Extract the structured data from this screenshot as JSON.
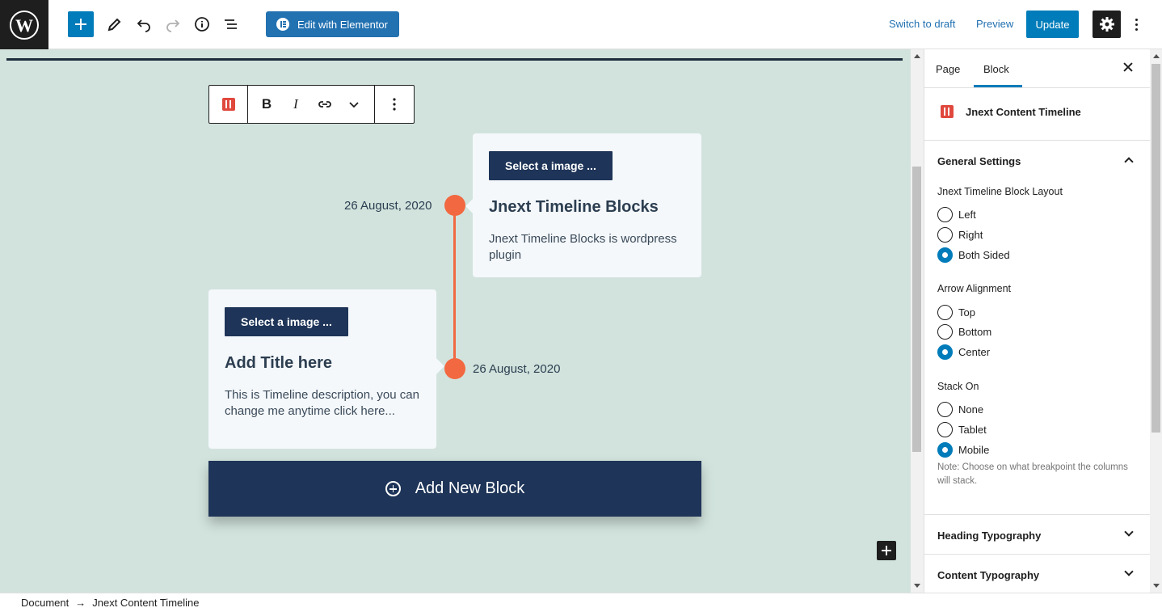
{
  "topbar": {
    "edit_elementor": "Edit with Elementor",
    "switch_to_draft": "Switch to draft",
    "preview": "Preview",
    "update": "Update"
  },
  "block_toolbar": {
    "bold": "B",
    "italic": "I"
  },
  "timeline": {
    "items": [
      {
        "date": "26 August, 2020",
        "button": "Select a image ...",
        "title": "Jnext Timeline Blocks",
        "description": "Jnext Timeline Blocks is wordpress plugin"
      },
      {
        "date": "26 August, 2020",
        "button": "Select a image ...",
        "title": "Add Title here",
        "description": "This is Timeline description, you can change me anytime click here..."
      }
    ],
    "add_new_block": "Add New Block"
  },
  "sidebar": {
    "tabs": [
      "Page",
      "Block"
    ],
    "block_name": "Jnext Content Timeline",
    "general_settings": "General Settings",
    "layout": {
      "label": "Jnext Timeline Block Layout",
      "options": [
        "Left",
        "Right",
        "Both Sided"
      ],
      "selected": "Both Sided"
    },
    "arrow": {
      "label": "Arrow Alignment",
      "options": [
        "Top",
        "Bottom",
        "Center"
      ],
      "selected": "Center"
    },
    "stack": {
      "label": "Stack On",
      "options": [
        "None",
        "Tablet",
        "Mobile"
      ],
      "selected": "Mobile",
      "note": "Note: Choose on what breakpoint the columns will stack."
    },
    "heading_typography": "Heading Typography",
    "content_typography": "Content Typography"
  },
  "breadcrumb": {
    "root": "Document",
    "separator": "→",
    "current": "Jnext Content Timeline"
  },
  "colors": {
    "accent": "#007cba",
    "canvas_bg": "#d2e3dd",
    "timeline": "#f26840",
    "navy": "#1e3458"
  }
}
